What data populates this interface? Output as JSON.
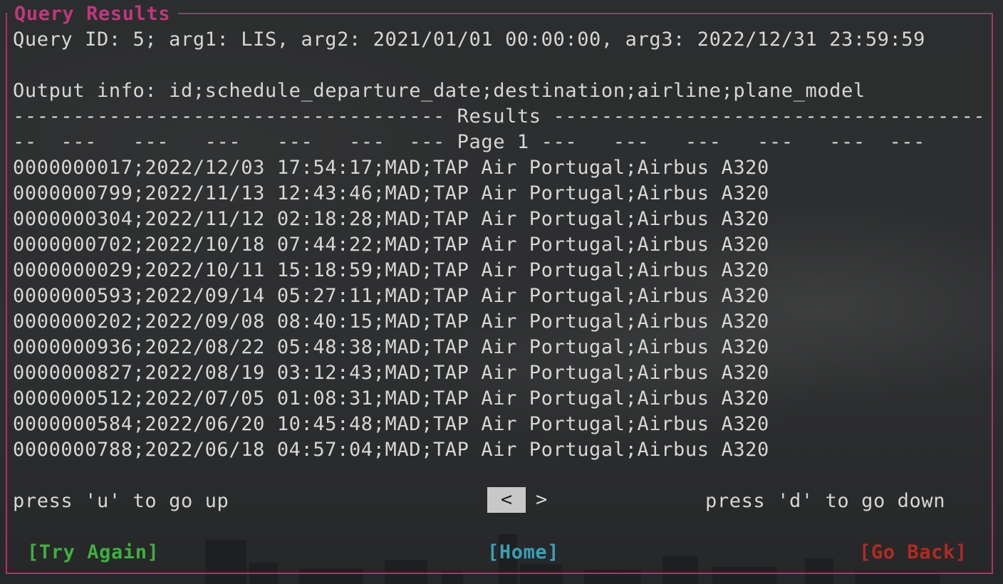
{
  "window": {
    "title": "Query Results"
  },
  "query": {
    "info_line": "Query ID: 5; arg1: LIS, arg2: 2021/01/01 00:00:00, arg3: 2022/12/31 23:59:59",
    "output_info": "Output info: id;schedule_departure_date;destination;airline;plane_model"
  },
  "results": {
    "header_line": "------------------------------------ Results ------------------------------------",
    "page_line": "--  ---   ---   ---   ---   ---  --- Page 1 ---   ---   ---   ---   ---  ---",
    "rows": [
      "0000000017;2022/12/03 17:54:17;MAD;TAP Air Portugal;Airbus A320",
      "0000000799;2022/11/13 12:43:46;MAD;TAP Air Portugal;Airbus A320",
      "0000000304;2022/11/12 02:18:28;MAD;TAP Air Portugal;Airbus A320",
      "0000000702;2022/10/18 07:44:22;MAD;TAP Air Portugal;Airbus A320",
      "0000000029;2022/10/11 15:18:59;MAD;TAP Air Portugal;Airbus A320",
      "0000000593;2022/09/14 05:27:11;MAD;TAP Air Portugal;Airbus A320",
      "0000000202;2022/09/08 08:40:15;MAD;TAP Air Portugal;Airbus A320",
      "0000000936;2022/08/22 05:48:38;MAD;TAP Air Portugal;Airbus A320",
      "0000000827;2022/08/19 03:12:43;MAD;TAP Air Portugal;Airbus A320",
      "0000000512;2022/07/05 01:08:31;MAD;TAP Air Portugal;Airbus A320",
      "0000000584;2022/06/20 10:45:48;MAD;TAP Air Portugal;Airbus A320",
      "0000000788;2022/06/18 04:57:04;MAD;TAP Air Portugal;Airbus A320"
    ]
  },
  "navigation": {
    "up_hint": "press 'u' to go up",
    "down_hint": "press 'd' to go down",
    "prev_label": "<",
    "next_label": ">"
  },
  "buttons": {
    "try_again": "[Try Again]",
    "home": "[Home]",
    "go_back": "[Go Back]"
  },
  "colors": {
    "frame": "#b0306e",
    "title": "#c2377b",
    "text": "#d6d6d6",
    "try_again": "#3fae3f",
    "home": "#3a9fb5",
    "go_back": "#b32a22"
  }
}
